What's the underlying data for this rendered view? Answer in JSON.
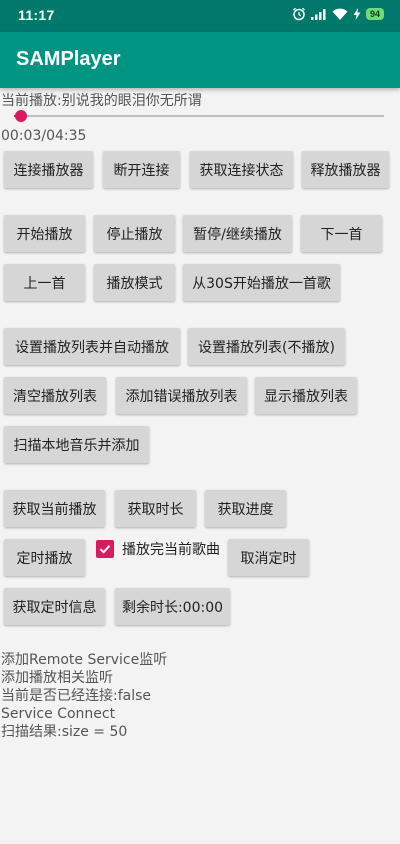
{
  "status_bar": {
    "time": "11:17",
    "battery": "94",
    "icons": [
      "alarm-icon",
      "signal-icon",
      "wifi-icon",
      "charging-icon",
      "battery-icon"
    ]
  },
  "app_bar": {
    "title": "SAMPlayer"
  },
  "now_playing": "当前播放:别说我的眼泪你无所谓",
  "seekbar": {
    "progress": 0.02,
    "color": "#d81b60"
  },
  "time_readout": "00:03/04:35",
  "buttons": {
    "connect": "连接播放器",
    "disconnect": "断开连接",
    "get_connect_state": "获取连接状态",
    "release_player": "释放播放器",
    "start": "开始播放",
    "stop": "停止播放",
    "pause_resume": "暂停/继续播放",
    "next": "下一首",
    "prev": "上一首",
    "play_mode": "播放模式",
    "play_from_30s": "从30S开始播放一首歌",
    "set_playlist_autoplay": "设置播放列表并自动播放",
    "set_playlist_noplay": "设置播放列表(不播放)",
    "clear_playlist": "清空播放列表",
    "add_error_playlist": "添加错误播放列表",
    "show_playlist": "显示播放列表",
    "scan_local_music": "扫描本地音乐并添加",
    "get_current": "获取当前播放",
    "get_duration": "获取时长",
    "get_progress": "获取进度",
    "timed_play": "定时播放",
    "cancel_timer": "取消定时",
    "get_timer_info": "获取定时信息",
    "remaining_time": "剩余时长:00:00"
  },
  "checkbox": {
    "label": "播放完当前歌曲",
    "checked": true
  },
  "log": [
    "添加Remote Service监听",
    "添加播放相关监听",
    "当前是否已经连接:false",
    "Service Connect",
    "扫描结果:size = 50"
  ],
  "colors": {
    "status_bar": "#00786a",
    "app_bar": "#009583",
    "accent": "#d81b60",
    "button": "#d6d6d6"
  }
}
